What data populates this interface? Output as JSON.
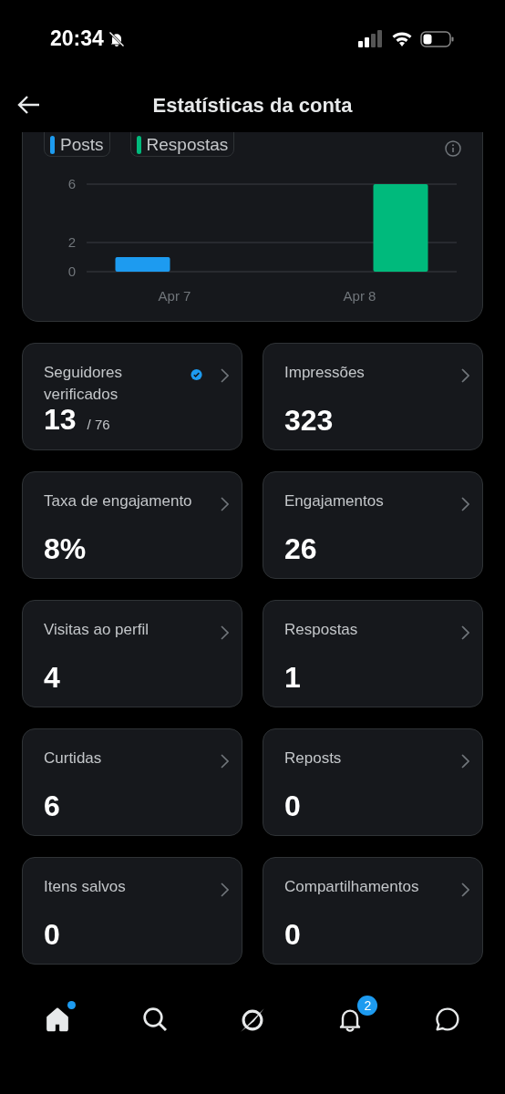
{
  "status_bar": {
    "time": "20:34"
  },
  "header": {
    "title": "Estatísticas da conta"
  },
  "chart": {
    "chart_data": {
      "type": "bar",
      "categories": [
        "Apr 7",
        "Apr 8"
      ],
      "series": [
        {
          "name": "Posts",
          "color": "#1d9bf0",
          "values": [
            1,
            null
          ]
        },
        {
          "name": "Respostas",
          "color": "#00ba7c",
          "values": [
            null,
            6
          ]
        }
      ],
      "ylim": [
        0,
        6
      ],
      "yticks": [
        0,
        2,
        6
      ]
    }
  },
  "stats": [
    {
      "label": "Seguidores verificados",
      "value": "13",
      "total": "/ 76",
      "verified": true
    },
    {
      "label": "Impressões",
      "value": "323",
      "verified": false
    },
    {
      "label": "Taxa de engajamento",
      "value": "8%",
      "verified": false
    },
    {
      "label": "Engajamentos",
      "value": "26",
      "verified": false
    },
    {
      "label": "Visitas ao perfil",
      "value": "4",
      "verified": false
    },
    {
      "label": "Respostas",
      "value": "1",
      "verified": false
    },
    {
      "label": "Curtidas",
      "value": "6",
      "verified": false
    },
    {
      "label": "Reposts",
      "value": "0",
      "verified": false
    },
    {
      "label": "Itens salvos",
      "value": "0",
      "verified": false
    },
    {
      "label": "Compartilhamentos",
      "value": "0",
      "verified": false
    }
  ],
  "nav": [
    {
      "kind": "home",
      "selected": true,
      "dot": true
    },
    {
      "kind": "search",
      "selected": false,
      "dot": false
    },
    {
      "kind": "grok",
      "selected": false,
      "dot": false
    },
    {
      "kind": "notifications",
      "selected": false,
      "dot": false,
      "badge": "2"
    },
    {
      "kind": "messages",
      "selected": false,
      "dot": false
    }
  ]
}
